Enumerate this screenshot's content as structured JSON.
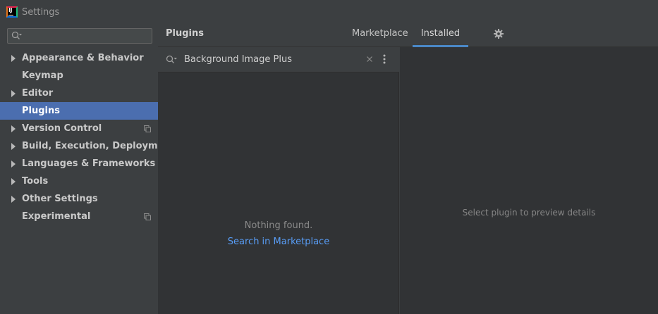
{
  "window": {
    "title": "Settings",
    "app_icon": "intellij-idea-icon"
  },
  "sidebar": {
    "search_placeholder": "",
    "items": [
      {
        "label": "Appearance & Behavior",
        "expandable": true,
        "selected": false,
        "project_icon": false
      },
      {
        "label": "Keymap",
        "expandable": false,
        "selected": false,
        "project_icon": false
      },
      {
        "label": "Editor",
        "expandable": true,
        "selected": false,
        "project_icon": false
      },
      {
        "label": "Plugins",
        "expandable": false,
        "selected": true,
        "project_icon": false
      },
      {
        "label": "Version Control",
        "expandable": true,
        "selected": false,
        "project_icon": true
      },
      {
        "label": "Build, Execution, Deployment",
        "expandable": true,
        "selected": false,
        "project_icon": false
      },
      {
        "label": "Languages & Frameworks",
        "expandable": true,
        "selected": false,
        "project_icon": false
      },
      {
        "label": "Tools",
        "expandable": true,
        "selected": false,
        "project_icon": false
      },
      {
        "label": "Other Settings",
        "expandable": true,
        "selected": false,
        "project_icon": false
      },
      {
        "label": "Experimental",
        "expandable": false,
        "selected": false,
        "project_icon": true
      }
    ]
  },
  "header": {
    "title": "Plugins",
    "tabs": [
      {
        "label": "Marketplace",
        "active": false
      },
      {
        "label": "Installed",
        "active": true
      }
    ],
    "settings_icon": "gear-icon"
  },
  "plugin_list": {
    "search_value": "Background Image Plus",
    "empty_message": "Nothing found.",
    "marketplace_link": "Search in Marketplace"
  },
  "details": {
    "placeholder": "Select plugin to preview details"
  },
  "colors": {
    "selection": "#4b6eaf",
    "link": "#589df6",
    "tab_underline": "#4a88c7",
    "panel": "#313335",
    "chrome": "#3c3f41"
  }
}
